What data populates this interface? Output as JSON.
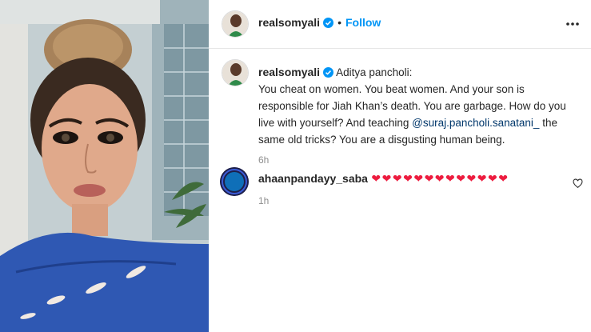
{
  "post": {
    "username": "realsomyali",
    "follow_label": "Follow",
    "separator": "•"
  },
  "caption": {
    "username": "realsomyali",
    "title": "Aditya pancholi:",
    "text_before_mention": "You cheat on women. You beat women. And your son is responsible for Jiah Khan’s death. You are garbage. How do you live with yourself? And teaching ",
    "mention": "@suraj.pancholi.sanatani_",
    "text_after_mention": " the same old tricks? You are a disgusting human being.",
    "time": "6h"
  },
  "comment": {
    "username": "ahaanpandayy_saba",
    "hearts": "❤❤❤❤❤❤❤❤❤❤❤❤❤",
    "time": "1h"
  },
  "colors": {
    "follow": "#0095f6",
    "mention": "#00376b",
    "heart": "#ed1c3f",
    "verified": "#0095f6"
  },
  "icons": [
    "verified-badge-icon",
    "more-options-icon",
    "heart-outline-icon"
  ]
}
